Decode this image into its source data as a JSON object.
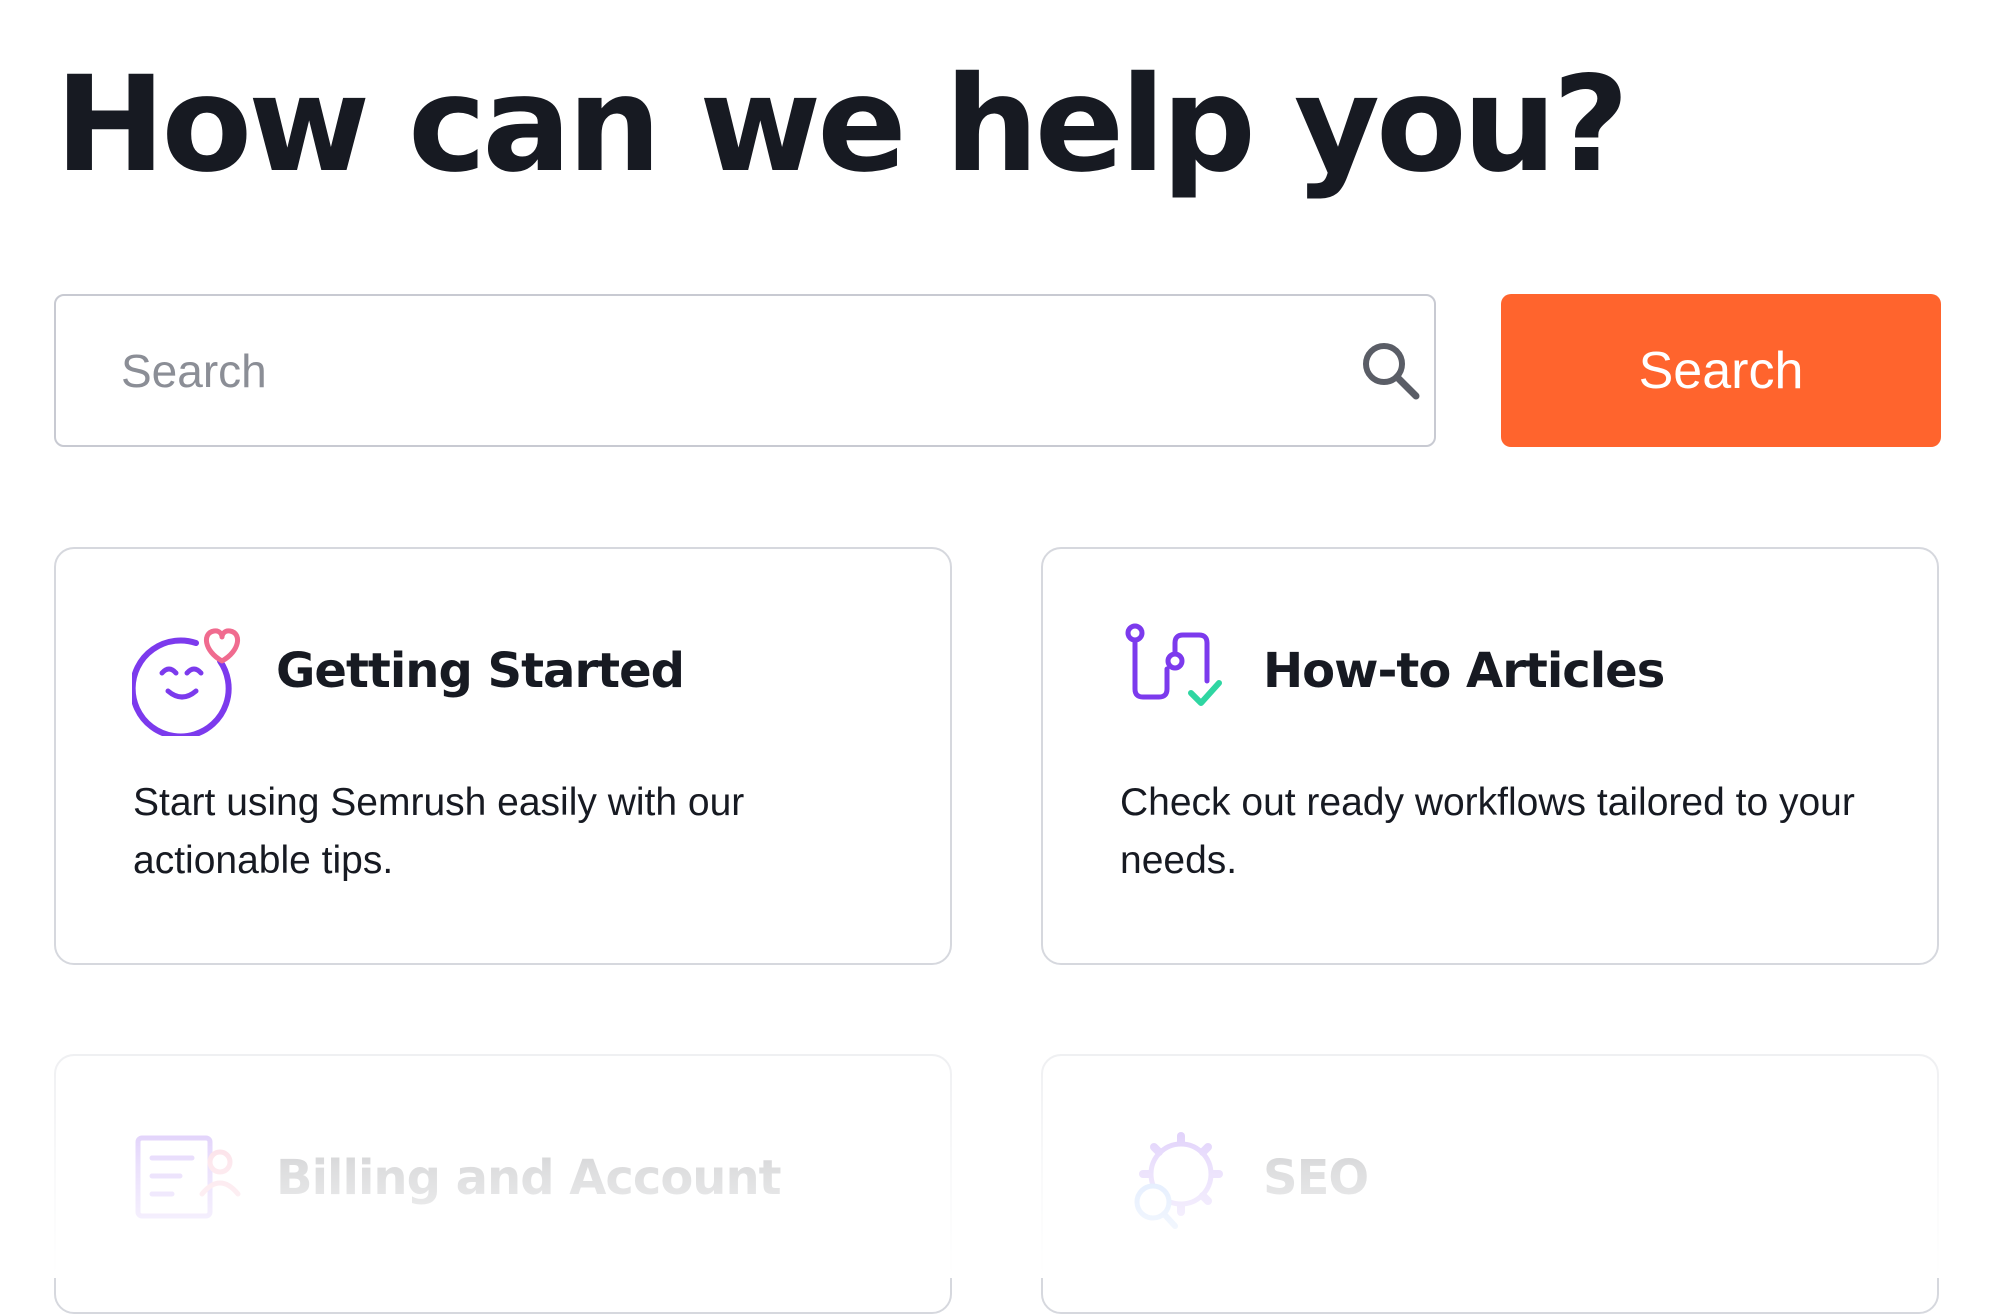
{
  "header": {
    "title": "How can we help you?"
  },
  "search": {
    "placeholder": "Search",
    "value": "",
    "button_label": "Search",
    "icon": "search-icon"
  },
  "colors": {
    "accent": "#ff642d",
    "text": "#171a22",
    "purple": "#7c3aed",
    "pink": "#f06b8f",
    "green": "#2fd6a2"
  },
  "cards": [
    {
      "title": "Getting Started",
      "description": "Start using Semrush easily with our actionable tips.",
      "icon": "smiley-heart-icon"
    },
    {
      "title": "How-to Articles",
      "description": "Check out ready workflows tailored to your needs.",
      "icon": "workflow-icon"
    },
    {
      "title": "Billing and Account",
      "icon": "billing-icon"
    },
    {
      "title": "SEO",
      "icon": "seo-gear-icon"
    }
  ]
}
